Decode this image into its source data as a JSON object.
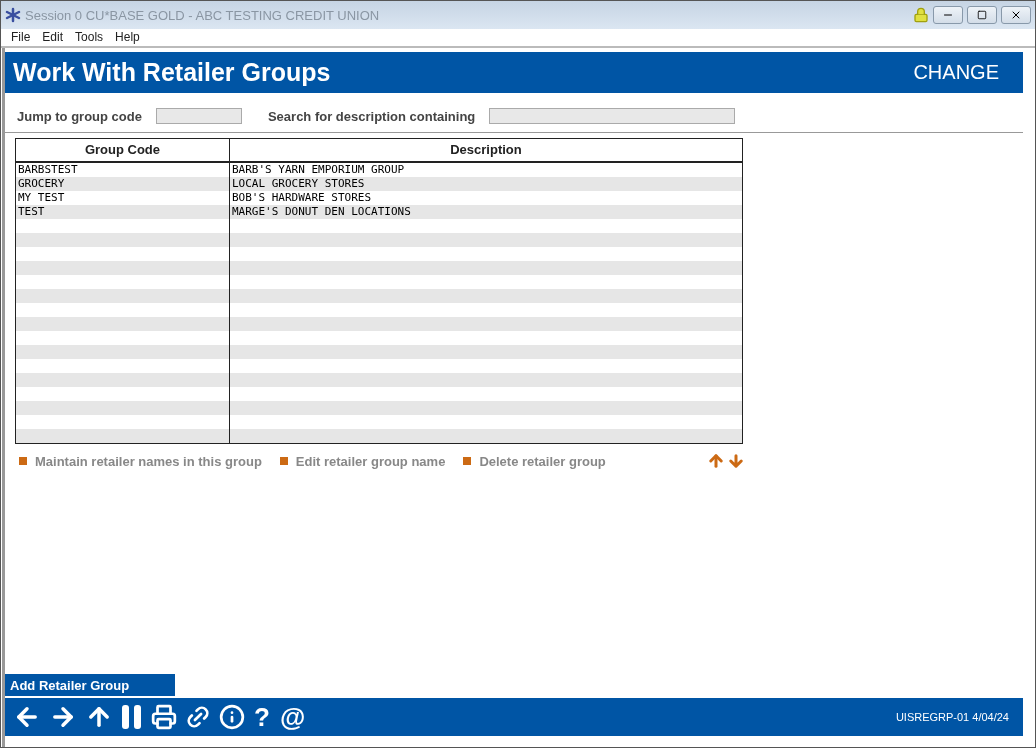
{
  "window": {
    "title": "Session 0 CU*BASE GOLD - ABC TESTING CREDIT UNION"
  },
  "menu": [
    "File",
    "Edit",
    "Tools",
    "Help"
  ],
  "header": {
    "title": "Work With Retailer Groups",
    "mode": "CHANGE"
  },
  "filters": [
    {
      "label": "Jump to group code"
    },
    {
      "label": "Search for description containing"
    }
  ],
  "table": {
    "columns": [
      "Group Code",
      "Description"
    ],
    "rows": [
      [
        "BARBSTEST",
        "BARB'S YARN EMPORIUM GROUP"
      ],
      [
        "GROCERY",
        "LOCAL GROCERY STORES"
      ],
      [
        "MY TEST",
        "BOB'S HARDWARE STORES"
      ],
      [
        "TEST",
        "MARGE'S DONUT DEN LOCATIONS"
      ]
    ]
  },
  "actions": [
    "Maintain retailer names in this group",
    "Edit retailer group name",
    "Delete retailer group"
  ],
  "add_button": "Add Retailer Group",
  "toolbar_glyphs": [
    "?",
    "@"
  ],
  "status": "UISREGRP-01 4/04/24"
}
